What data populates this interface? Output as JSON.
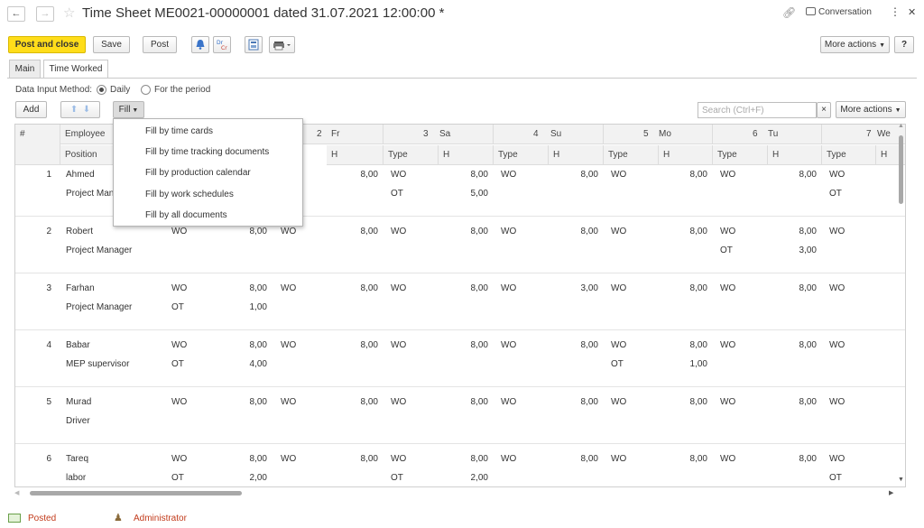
{
  "window": {
    "title": "Time Sheet ME0021-00000001 dated 31.07.2021 12:00:00 *",
    "back_glyph": "←",
    "forward_glyph": "→",
    "conversation_label": "Conversation",
    "more_glyph": "⋮",
    "close_glyph": "✕"
  },
  "toolbar": {
    "post_close": "Post and close",
    "save": "Save",
    "post": "Post",
    "more_actions": "More actions",
    "help": "?"
  },
  "tabs": [
    {
      "label": "Main",
      "active": false
    },
    {
      "label": "Time Worked",
      "active": true
    }
  ],
  "input_method": {
    "label": "Data Input Method:",
    "options": [
      "Daily",
      "For the period"
    ],
    "selected": "Daily"
  },
  "table_toolbar": {
    "add": "Add",
    "fill": "Fill",
    "search_placeholder": "Search (Ctrl+F)",
    "clear": "×",
    "more_actions": "More actions"
  },
  "fill_menu": [
    "Fill by time cards",
    "Fill by time tracking documents",
    "Fill by production calendar",
    "Fill by work schedules",
    "Fill by all documents"
  ],
  "grid": {
    "header_row1": [
      "#",
      "Employee",
      "2",
      "Fr",
      "3",
      "Sa",
      "4",
      "Su",
      "5",
      "Mo",
      "6",
      "Tu",
      "7",
      "We"
    ],
    "header_row2": [
      "Position",
      "H",
      "Type",
      "H",
      "Type",
      "H",
      "Type",
      "H",
      "Type",
      "H",
      "Type",
      "H"
    ],
    "rows": [
      {
        "n": "1",
        "employee": "Ahmed",
        "position": "Project Man",
        "r1": [
          "",
          "",
          "WO",
          "8,00",
          "WO",
          "8,00",
          "WO",
          "8,00",
          "WO",
          "8,00",
          "WO",
          "8,00",
          "WO"
        ],
        "r2": [
          "",
          "",
          "",
          "",
          "OT",
          "5,00",
          "",
          "",
          "",
          "",
          "",
          "",
          "OT"
        ]
      },
      {
        "n": "2",
        "employee": "Robert",
        "position": "Project Manager",
        "r1": [
          "WO",
          "8,00",
          "WO",
          "8,00",
          "WO",
          "8,00",
          "WO",
          "8,00",
          "WO",
          "8,00",
          "WO",
          "8,00",
          "WO"
        ],
        "r2": [
          "",
          "",
          "",
          "",
          "",
          "",
          "",
          "",
          "",
          "",
          "OT",
          "3,00",
          ""
        ]
      },
      {
        "n": "3",
        "employee": "Farhan",
        "position": "Project Manager",
        "r1": [
          "WO",
          "8,00",
          "WO",
          "8,00",
          "WO",
          "8,00",
          "WO",
          "3,00",
          "WO",
          "8,00",
          "WO",
          "8,00",
          "WO"
        ],
        "r2": [
          "OT",
          "1,00",
          "",
          "",
          "",
          "",
          "",
          "",
          "",
          "",
          "",
          "",
          ""
        ]
      },
      {
        "n": "4",
        "employee": "Babar",
        "position": "MEP supervisor",
        "r1": [
          "WO",
          "8,00",
          "WO",
          "8,00",
          "WO",
          "8,00",
          "WO",
          "8,00",
          "WO",
          "8,00",
          "WO",
          "8,00",
          "WO"
        ],
        "r2": [
          "OT",
          "4,00",
          "",
          "",
          "",
          "",
          "",
          "",
          "OT",
          "1,00",
          "",
          "",
          ""
        ]
      },
      {
        "n": "5",
        "employee": "Murad",
        "position": "Driver",
        "r1": [
          "WO",
          "8,00",
          "WO",
          "8,00",
          "WO",
          "8,00",
          "WO",
          "8,00",
          "WO",
          "8,00",
          "WO",
          "8,00",
          "WO"
        ],
        "r2": [
          "",
          "",
          "",
          "",
          "",
          "",
          "",
          "",
          "",
          "",
          "",
          "",
          ""
        ]
      },
      {
        "n": "6",
        "employee": "Tareq",
        "position": "labor",
        "r1": [
          "WO",
          "8,00",
          "WO",
          "8,00",
          "WO",
          "8,00",
          "WO",
          "8,00",
          "WO",
          "8,00",
          "WO",
          "8,00",
          "WO"
        ],
        "r2": [
          "OT",
          "2,00",
          "",
          "",
          "OT",
          "2,00",
          "",
          "",
          "",
          "",
          "",
          "",
          "OT"
        ]
      }
    ]
  },
  "status": {
    "posted": "Posted",
    "user": "Administrator"
  },
  "colors": {
    "primary_button": "#ffdd1a",
    "posted_text": "#c23a1a",
    "user_text": "#c23a1a"
  }
}
